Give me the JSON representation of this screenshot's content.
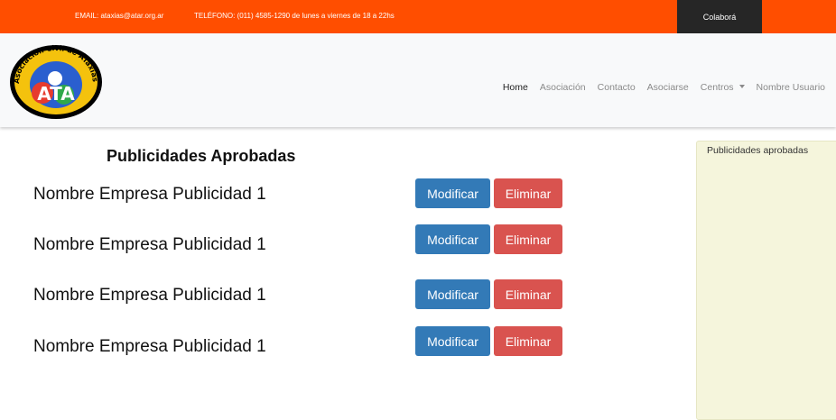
{
  "topbar": {
    "email": "EMAIL: ataxias@atar.org.ar",
    "phone": "TELÉFONO: (011) 4585-1290 de lunes a viernes de 18 a 22hs",
    "cta_label": "Colaborá",
    "bg_color": "#ff4e00"
  },
  "navbar": {
    "logo_text": "Asociación Civil de ATaxias de ARgentina",
    "logo_letters": "ATA",
    "items": [
      {
        "label": "Home",
        "active": true
      },
      {
        "label": "Asociación",
        "active": false
      },
      {
        "label": "Contacto",
        "active": false
      },
      {
        "label": "Asociarse",
        "active": false
      },
      {
        "label": "Centros",
        "active": false,
        "dropdown": true
      },
      {
        "label": "Nombre Usuario",
        "active": false
      }
    ]
  },
  "main": {
    "title": "Publicidades Aprobadas",
    "rows": [
      {
        "name": "Nombre Empresa Publicidad 1",
        "edit_label": "Modificar",
        "delete_label": "Eliminar"
      },
      {
        "name": "Nombre Empresa Publicidad 1",
        "edit_label": "Modificar",
        "delete_label": "Eliminar"
      },
      {
        "name": "Nombre Empresa Publicidad 1",
        "edit_label": "Modificar",
        "delete_label": "Eliminar"
      },
      {
        "name": "Nombre Empresa Publicidad 1",
        "edit_label": "Modificar",
        "delete_label": "Eliminar"
      }
    ]
  },
  "sidebar": {
    "title": "Publicidades aprobadas"
  },
  "colors": {
    "primary": "#337ab7",
    "danger": "#d9534f",
    "sidebar_bg": "#f5f5dc"
  }
}
